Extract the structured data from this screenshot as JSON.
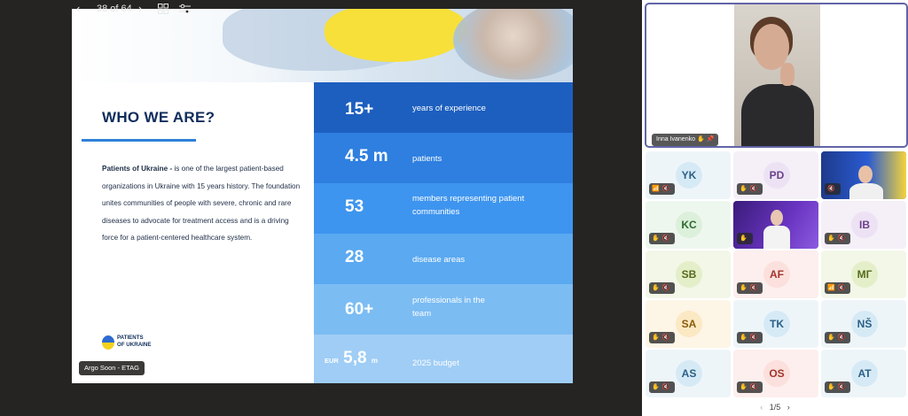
{
  "slide": {
    "heading": "WHO WE ARE?",
    "description_bold": "Patients of Ukraine - ",
    "description_rest": "is one of the largest patient-based organizations in  Ukraine with 15 years history. The foundation unites communities of people with severe, chronic and rare diseases to advocate for treatment access and is a driving force for a patient-centered healthcare system.",
    "logo_text_line1": "PATIENTS",
    "logo_text_line2": "OF UKRAINE",
    "presenter_tag": "Argo Soon - ETAG",
    "stats": [
      {
        "number": "15+",
        "label": "years of experience",
        "color": "#1d5fbf"
      },
      {
        "number": "4.5 m",
        "label": "patients",
        "color": "#2e7fe0"
      },
      {
        "number": "53",
        "label": "members representing patient communities",
        "color": "#3e95ef"
      },
      {
        "number": "28",
        "label": "disease areas",
        "color": "#5aa9f1"
      },
      {
        "number": "60+",
        "label": "professionals in the team",
        "color": "#7bbcf3"
      },
      {
        "number_prefix": "EUR",
        "number": "5,8",
        "number_suffix": "m",
        "label": "2025 budget",
        "color": "#9fcdf5"
      }
    ]
  },
  "controls": {
    "prev_icon": "chevron-left-icon",
    "page_label": "38 of 64",
    "next_icon": "chevron-right-icon",
    "grid_icon": "grid-icon",
    "settings_icon": "sliders-icon"
  },
  "gallery": {
    "active_speaker": "Inna Ivanenko",
    "accent": "#6264a7",
    "participants": [
      {
        "initials": "YK",
        "bg": "#d6eaf6",
        "fg": "#2c5f86",
        "tile": "#eef5f9",
        "icons": "signal mic-off"
      },
      {
        "initials": "PD",
        "bg": "#ece2f4",
        "fg": "#6b3f8a",
        "tile": "#f5eff8",
        "icons": "hand mic-off"
      },
      {
        "initials": "",
        "video": "conference-banner",
        "tile": "#1e3b8c",
        "icons": "mic-off"
      },
      {
        "initials": "KC",
        "bg": "#dcf0dc",
        "fg": "#2d6b2d",
        "tile": "#eef7ee",
        "icons": "hand mic-off"
      },
      {
        "initials": "",
        "video": "presenter",
        "tile": "#5a2aa8",
        "icons": "hand"
      },
      {
        "initials": "IB",
        "bg": "#ece2f4",
        "fg": "#6b3f8a",
        "tile": "#f5eff8",
        "icons": "hand mic-off"
      },
      {
        "initials": "SB",
        "bg": "#e4efc9",
        "fg": "#546b1c",
        "tile": "#f3f7e8",
        "icons": "hand mic-off"
      },
      {
        "initials": "AF",
        "bg": "#fbe0dd",
        "fg": "#a2362c",
        "tile": "#fcefed",
        "icons": "hand mic-off"
      },
      {
        "initials": "МГ",
        "bg": "#e4efc9",
        "fg": "#546b1c",
        "tile": "#f3f7e8",
        "icons": "signal mic-off"
      },
      {
        "initials": "SA",
        "bg": "#fbe9c4",
        "fg": "#8a5a0d",
        "tile": "#fdf5e6",
        "icons": "hand mic-off"
      },
      {
        "initials": "TK",
        "bg": "#d6eaf6",
        "fg": "#2c5f86",
        "tile": "#eef5f9",
        "icons": "hand mic-off"
      },
      {
        "initials": "NŠ",
        "bg": "#d6eaf6",
        "fg": "#2c5f86",
        "tile": "#eef5f9",
        "icons": "hand mic-off"
      },
      {
        "initials": "AS",
        "bg": "#d6eaf6",
        "fg": "#2c5f86",
        "tile": "#eef5f9",
        "icons": "hand mic-off"
      },
      {
        "initials": "OS",
        "bg": "#fbe0dd",
        "fg": "#a2362c",
        "tile": "#fcefed",
        "icons": "hand mic-off"
      },
      {
        "initials": "AT",
        "bg": "#d6eaf6",
        "fg": "#2c5f86",
        "tile": "#eef5f9",
        "icons": "hand mic-off"
      }
    ],
    "pager": "1/5"
  }
}
